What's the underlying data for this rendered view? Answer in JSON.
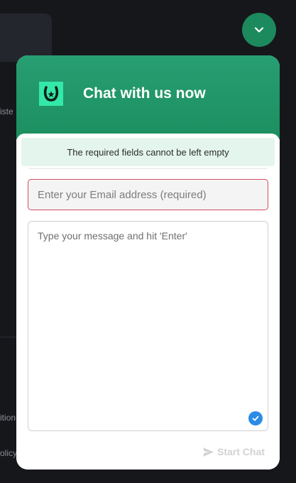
{
  "background": {
    "side_texts": [
      "iste",
      "ition",
      "olicy"
    ]
  },
  "widget": {
    "title": "Chat with us now",
    "notice": "The required fields cannot be left empty",
    "email_placeholder": "Enter your Email address (required)",
    "message_placeholder": "Type your message and hit 'Enter'",
    "start_chat_label": "Start Chat"
  },
  "icons": {
    "toggle": "chevron-down-icon",
    "logo": "horseshoe-icon",
    "check": "check-icon",
    "send": "send-icon"
  },
  "colors": {
    "accent": "#1c8a5c",
    "header": "#279e73",
    "logo_bg": "#33e8a8",
    "error_border": "#d0505e",
    "notice_bg": "#e4f5ee",
    "check": "#2b8ce6"
  }
}
